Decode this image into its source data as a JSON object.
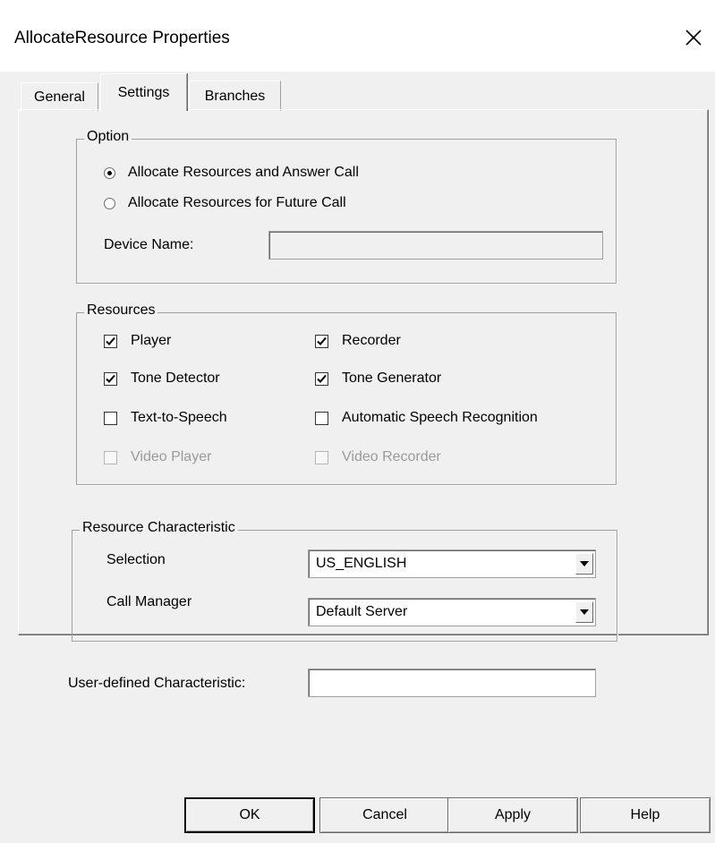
{
  "window": {
    "title": "AllocateResource Properties"
  },
  "tabs": [
    {
      "label": "General"
    },
    {
      "label": "Settings"
    },
    {
      "label": "Branches"
    }
  ],
  "option_group": {
    "label": "Option",
    "radio_answer_call": {
      "label": "Allocate Resources and Answer Call",
      "selected": true
    },
    "radio_future_call": {
      "label": "Allocate Resources for Future Call",
      "selected": false
    },
    "device_name": {
      "label": "Device Name:",
      "value": ""
    }
  },
  "resources_group": {
    "label": "Resources",
    "items": [
      {
        "label": "Player",
        "checked": true,
        "enabled": true
      },
      {
        "label": "Recorder",
        "checked": true,
        "enabled": true
      },
      {
        "label": "Tone Detector",
        "checked": true,
        "enabled": true
      },
      {
        "label": "Tone Generator",
        "checked": true,
        "enabled": true
      },
      {
        "label": "Text-to-Speech",
        "checked": false,
        "enabled": true
      },
      {
        "label": "Automatic Speech Recognition",
        "checked": false,
        "enabled": true
      },
      {
        "label": "Video Player",
        "checked": false,
        "enabled": false
      },
      {
        "label": "Video Recorder",
        "checked": false,
        "enabled": false
      }
    ]
  },
  "characteristic_group": {
    "label": "Resource Characteristic",
    "selection": {
      "label": "Selection",
      "value": "US_ENGLISH"
    },
    "call_manager": {
      "label": "Call Manager",
      "value": "Default Server"
    }
  },
  "user_defined": {
    "label": "User-defined Characteristic:",
    "value": ""
  },
  "buttons": {
    "ok": "OK",
    "cancel": "Cancel",
    "apply": "Apply",
    "help": "Help"
  }
}
